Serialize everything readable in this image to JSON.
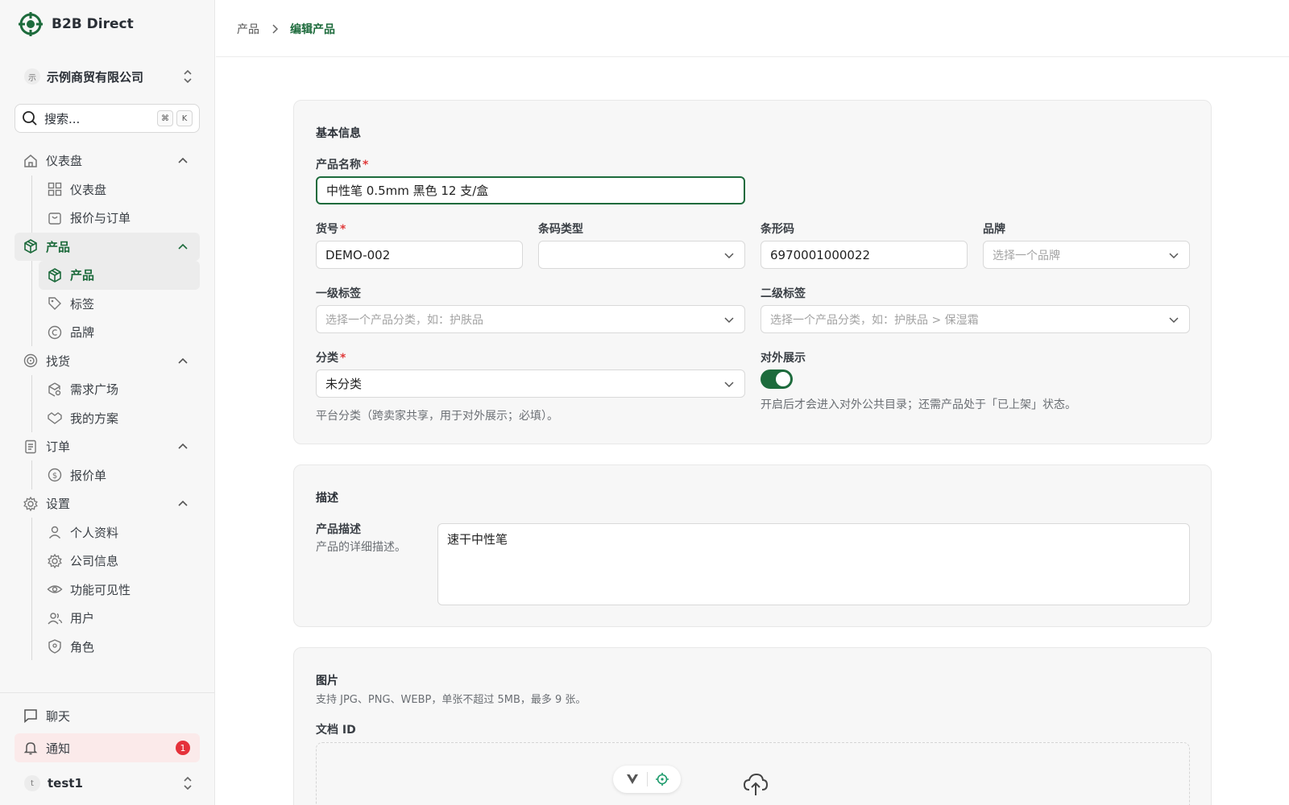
{
  "brand": {
    "name": "B2B Direct"
  },
  "org": {
    "avatar": "示",
    "name": "示例商贸有限公司"
  },
  "search": {
    "placeholder": "搜索...",
    "kbd1": "⌘",
    "kbd2": "K"
  },
  "nav": {
    "dashboard_group": "仪表盘",
    "dashboard": "仪表盘",
    "quotes_orders": "报价与订单",
    "products_group": "产品",
    "products": "产品",
    "tags": "标签",
    "brands": "品牌",
    "sourcing_group": "找货",
    "demand_plaza": "需求广场",
    "my_plans": "我的方案",
    "orders_group": "订单",
    "quotes": "报价单",
    "settings_group": "设置",
    "profile": "个人资料",
    "company_info": "公司信息",
    "feature_visibility": "功能可见性",
    "users": "用户",
    "roles": "角色",
    "chat": "聊天",
    "notifications": "通知",
    "notifications_count": "1"
  },
  "user": {
    "avatar": "t",
    "name": "test1"
  },
  "breadcrumb": {
    "parent": "产品",
    "current": "编辑产品"
  },
  "basic": {
    "title": "基本信息",
    "name_label": "产品名称",
    "name_value": "中性笔 0.5mm 黑色 12 支/盒",
    "sku_label": "货号",
    "sku_value": "DEMO-002",
    "barcode_type_label": "条码类型",
    "barcode_type_value": "",
    "barcode_label": "条形码",
    "barcode_value": "6970001000022",
    "brand_label": "品牌",
    "brand_placeholder": "选择一个品牌",
    "tag1_label": "一级标签",
    "tag1_placeholder": "选择一个产品分类，如：护肤品",
    "tag2_label": "二级标签",
    "tag2_placeholder": "选择一个产品分类，如：护肤品 > 保湿霜",
    "category_label": "分类",
    "category_value": "未分类",
    "category_help": "平台分类（跨卖家共享，用于对外展示；必填）。",
    "public_label": "对外展示",
    "public_on": true,
    "public_help": "开启后才会进入对外公共目录；还需产品处于「已上架」状态。"
  },
  "description": {
    "title": "描述",
    "label": "产品描述",
    "help": "产品的详细描述。",
    "value": "速干中性笔"
  },
  "images": {
    "title": "图片",
    "help": "支持 JPG、PNG、WEBP，单张不超过 5MB，最多 9 张。",
    "doc_id_label": "文档 ID"
  },
  "colors": {
    "accent": "#1d6b3c",
    "badge": "#e5313a"
  }
}
